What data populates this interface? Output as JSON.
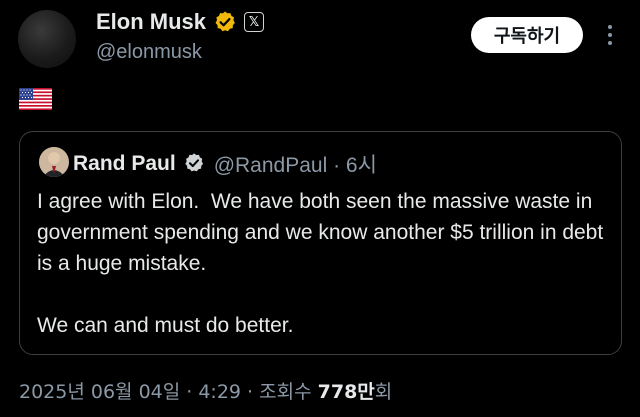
{
  "post": {
    "author_name": "Elon Musk",
    "author_handle": "@elonmusk",
    "subscribe_label": "구독하기",
    "body_emoji": "🇺🇸",
    "icons": {
      "verified": "verified-badge-icon",
      "affiliate": "x-logo-icon",
      "more": "more-options-icon"
    },
    "colors": {
      "verified": "#f0b90b",
      "background": "#000000",
      "muted": "#8b98a5"
    }
  },
  "quoted": {
    "author_name": "Rand Paul",
    "author_handle": "@RandPaul · 6시",
    "text": "I agree with Elon.  We have both seen the massive waste in government spending and we know another $5 trillion in debt is a huge mistake.\n\nWe can and must do better.",
    "icons": {
      "verified": "verified-badge-icon"
    },
    "colors": {
      "verified": "#d0d3d6"
    }
  },
  "footer": {
    "timestamp": "2025년 06월 04일 · 4:29 · 조회수",
    "views": "778만",
    "views_suffix": "회"
  }
}
